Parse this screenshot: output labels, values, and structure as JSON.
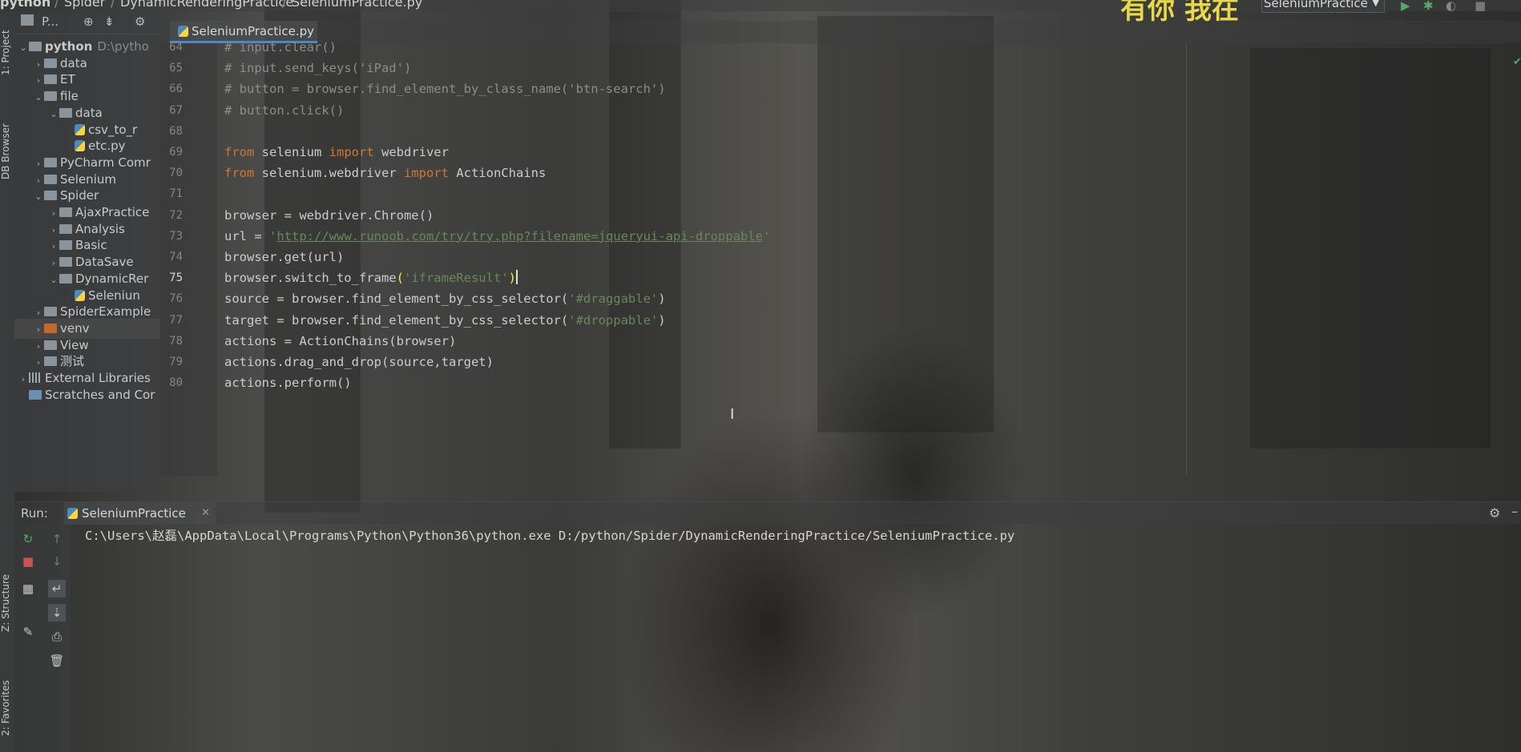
{
  "breadcrumb": {
    "items": [
      "python",
      "Spider",
      "DynamicRenderingPractice",
      "SeleniumPractice.py"
    ],
    "overlay_text": "有你 我在"
  },
  "run_configuration": {
    "selected": "SeleniumPractice"
  },
  "tool_stripe": {
    "project_label": "1: Project",
    "db_label": "DB Browser",
    "structure_label": "Z: Structure",
    "favorites_label": "2: Favorites"
  },
  "project_panel": {
    "header_label": "P...",
    "tree": [
      {
        "label": "python",
        "extra": "D:\\pytho",
        "type": "folder",
        "expanded": true
      },
      {
        "label": "data",
        "type": "folder"
      },
      {
        "label": "ET",
        "type": "folder"
      },
      {
        "label": "file",
        "type": "folder",
        "expanded": true
      },
      {
        "label": "data",
        "type": "folder",
        "expanded": true
      },
      {
        "label": "csv_to_r",
        "type": "py"
      },
      {
        "label": "etc.py",
        "type": "py"
      },
      {
        "label": "PyCharm Comr",
        "type": "folder"
      },
      {
        "label": "Selenium",
        "type": "folder"
      },
      {
        "label": "Spider",
        "type": "folder",
        "expanded": true
      },
      {
        "label": "AjaxPractice",
        "type": "folder"
      },
      {
        "label": "Analysis",
        "type": "folder"
      },
      {
        "label": "Basic",
        "type": "folder"
      },
      {
        "label": "DataSave",
        "type": "folder"
      },
      {
        "label": "DynamicRer",
        "type": "folder",
        "expanded": true
      },
      {
        "label": "Seleniun",
        "type": "py"
      },
      {
        "label": "SpiderExample",
        "type": "folder"
      },
      {
        "label": "venv",
        "type": "folder-orange"
      },
      {
        "label": "View",
        "type": "folder"
      },
      {
        "label": "测试",
        "type": "folder"
      },
      {
        "label": "External Libraries",
        "type": "lib"
      },
      {
        "label": "Scratches and Cor",
        "type": "scratch"
      }
    ]
  },
  "editor": {
    "tab_label": "SeleniumPractice.py",
    "current_line": "75",
    "lines": [
      {
        "n": "64",
        "code": "# input.clear()"
      },
      {
        "n": "65",
        "code": "# input.send_keys('iPad')"
      },
      {
        "n": "66",
        "code": "# button = browser.find_element_by_class_name('btn-search')"
      },
      {
        "n": "67",
        "code": "# button.click()"
      },
      {
        "n": "68",
        "code": ""
      },
      {
        "n": "69",
        "kw1": "from",
        "mid": " selenium ",
        "kw2": "import",
        "rest": " webdriver"
      },
      {
        "n": "70",
        "kw1": "from",
        "mid": " selenium.webdriver ",
        "kw2": "import",
        "rest": " ActionChains"
      },
      {
        "n": "71",
        "code": ""
      },
      {
        "n": "72",
        "code": "browser = webdriver.Chrome()"
      },
      {
        "n": "73",
        "pre": "url = ",
        "q1": "'",
        "url": "http://www.runoob.com/try/try.php?filename=jqueryui-api-droppable",
        "q2": "'"
      },
      {
        "n": "74",
        "code": "browser.get(url)"
      },
      {
        "n": "75",
        "pre": "browser.switch_to_frame",
        "open": "(",
        "str": "'iframeResult'",
        "close": ")"
      },
      {
        "n": "76",
        "pre": "source = browser.find_element_by_css_selector(",
        "str": "'#draggable'",
        "post": ")"
      },
      {
        "n": "77",
        "pre": "target = browser.find_element_by_css_selector(",
        "str": "'#droppable'",
        "post": ")"
      },
      {
        "n": "78",
        "code": "actions = ActionChains(browser)"
      },
      {
        "n": "79",
        "code": "actions.drag_and_drop(source,target)"
      },
      {
        "n": "80",
        "code": "actions.perform()"
      }
    ]
  },
  "run_panel": {
    "label": "Run:",
    "tab_label": "SeleniumPractice",
    "console_line": "C:\\Users\\赵磊\\AppData\\Local\\Programs\\Python\\Python36\\python.exe D:/python/Spider/DynamicRenderingPractice/SeleniumPractice.py"
  }
}
